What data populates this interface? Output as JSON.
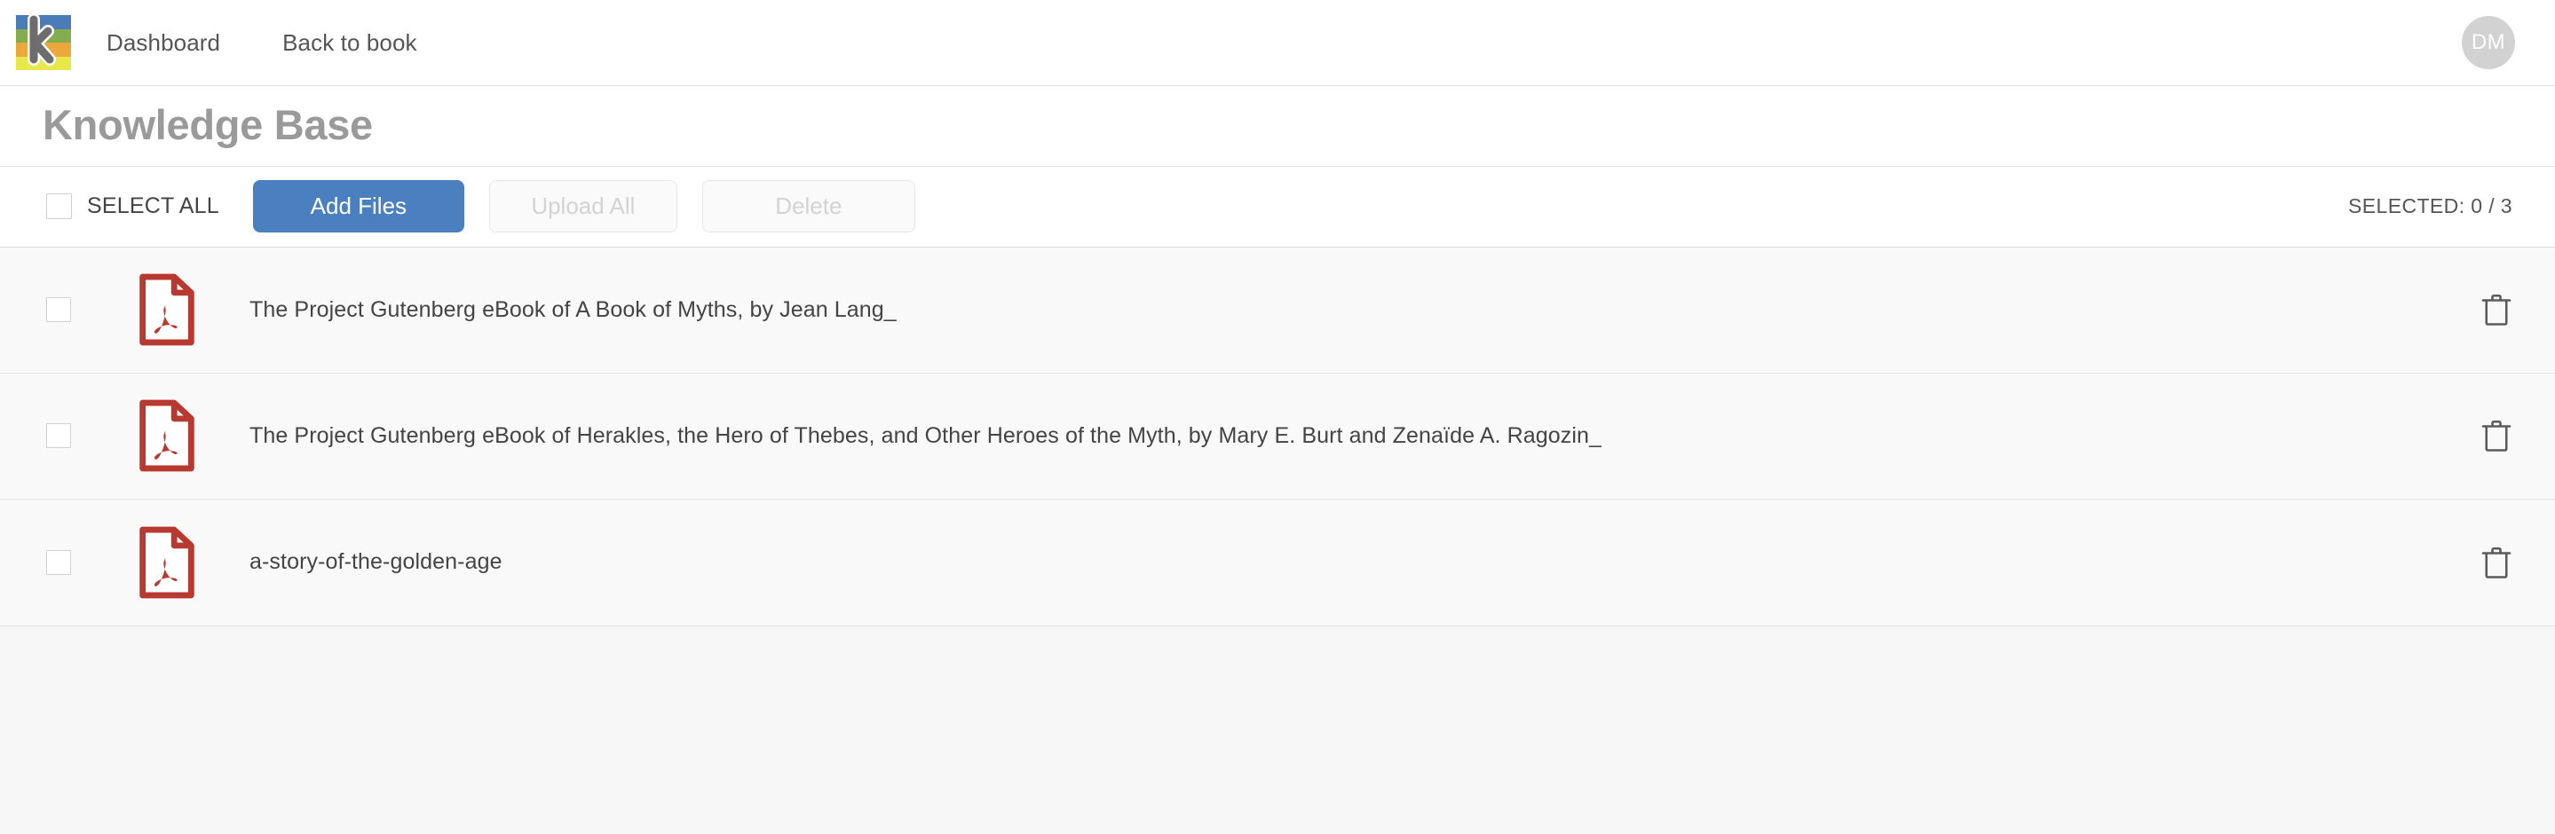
{
  "navbar": {
    "logo_name": "knowledge-base-logo",
    "logo_letter": "k",
    "links": [
      {
        "label": "Dashboard",
        "name": "nav-link-dashboard"
      },
      {
        "label": "Back to book",
        "name": "nav-link-back-to-book"
      }
    ],
    "avatar_initials": "DM"
  },
  "page": {
    "title": "Knowledge Base"
  },
  "toolbar": {
    "select_all_label": "SELECT ALL",
    "add_files_label": "Add Files",
    "upload_all_label": "Upload All",
    "delete_label": "Delete",
    "selected_count_label": "SELECTED: 0 / 3"
  },
  "files": [
    {
      "name": "The Project Gutenberg eBook of A Book of Myths, by Jean Lang_",
      "type": "pdf",
      "checked": false
    },
    {
      "name": "The Project Gutenberg eBook of Herakles, the Hero of Thebes, and Other Heroes of the Myth, by Mary E. Burt and Zenaïde A. Ragozin_",
      "type": "pdf",
      "checked": false
    },
    {
      "name": "a-story-of-the-golden-age",
      "type": "pdf",
      "checked": false
    }
  ],
  "colors": {
    "primary_button": "#4a80bf",
    "pdf_icon": "#b8392f",
    "title_text": "#9a9a9a",
    "logo_blue": "#4a7cb8",
    "logo_green": "#84ad50",
    "logo_orange": "#eaa83d",
    "logo_yellow": "#e9e84a"
  }
}
